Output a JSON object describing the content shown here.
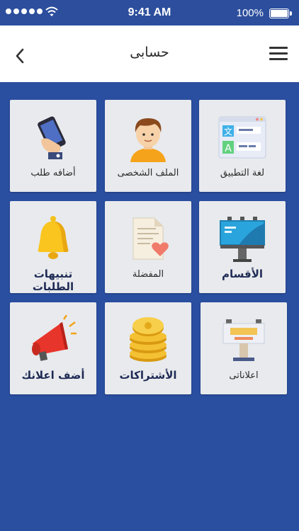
{
  "status_bar": {
    "time": "9:41 AM",
    "battery": "100%",
    "icons": [
      "signal-dots-icon",
      "wifi-icon",
      "battery-icon"
    ]
  },
  "header": {
    "title": "حسابى",
    "back_icon": "chevron-left-icon",
    "menu_icon": "hamburger-menu-icon"
  },
  "tiles": [
    {
      "label": "لغة التطبيق",
      "icon": "app-language-icon"
    },
    {
      "label": "الملف الشخصى",
      "icon": "profile-avatar-icon"
    },
    {
      "label": "أضافه طلب",
      "icon": "add-request-phone-icon"
    },
    {
      "label": "الأقسام",
      "icon": "categories-billboard-icon"
    },
    {
      "label": "المفضلة",
      "icon": "favorites-document-icon"
    },
    {
      "label": "تنبيهات الطلبات",
      "icon": "request-alerts-bell-icon"
    },
    {
      "label": "اعلاناتى",
      "icon": "my-ads-billboard-icon"
    },
    {
      "label": "الأشتراكات",
      "icon": "subscriptions-coins-icon"
    },
    {
      "label": "أضف اعلانك",
      "icon": "add-ad-megaphone-icon"
    }
  ],
  "colors": {
    "background": "#2a4ea0",
    "tile": "#e8eaed",
    "header": "#ffffff"
  }
}
